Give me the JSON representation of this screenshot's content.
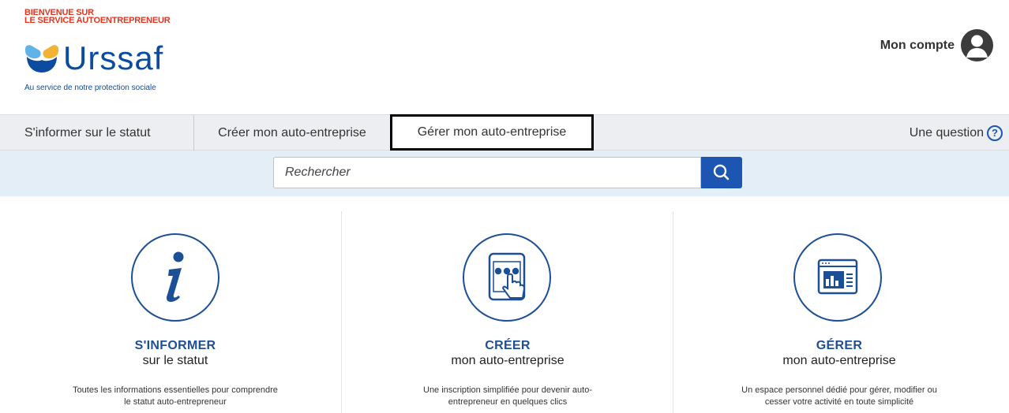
{
  "header": {
    "welcome_line1": "BIENVENUE SUR",
    "welcome_line2": "LE SERVICE AUTOENTREPRENEUR",
    "logo_text": "Urssaf",
    "tagline": "Au service de notre protection sociale",
    "account_label": "Mon compte",
    "account_icon": "user-avatar-icon",
    "brand_color": "#0b4ca0",
    "welcome_color": "#e2351f"
  },
  "nav": {
    "items": [
      {
        "label": "S'informer sur le statut"
      },
      {
        "label": "Créer mon auto-entreprise"
      },
      {
        "label": "Gérer mon auto-entreprise",
        "highlighted": true
      }
    ],
    "help_label": "Une question",
    "help_icon": "question-circle-icon"
  },
  "search": {
    "placeholder": "Rechercher",
    "button_icon": "search-icon",
    "button_color": "#1d55b3"
  },
  "cards": [
    {
      "icon": "info-icon",
      "title": "S'INFORMER",
      "subtitle": "sur le statut",
      "description": "Toutes les informations essentielles pour comprendre le statut auto-entrepreneur"
    },
    {
      "icon": "tablet-touch-icon",
      "title": "CRÉER",
      "subtitle": "mon auto-entreprise",
      "description": "Une inscription simplifiée pour devenir auto-entrepreneur en quelques clics"
    },
    {
      "icon": "dashboard-chart-icon",
      "title": "GÉRER",
      "subtitle": "mon auto-entreprise",
      "description": "Un espace personnel dédié pour gérer, modifier ou cesser votre activité en toute simplicité"
    }
  ]
}
